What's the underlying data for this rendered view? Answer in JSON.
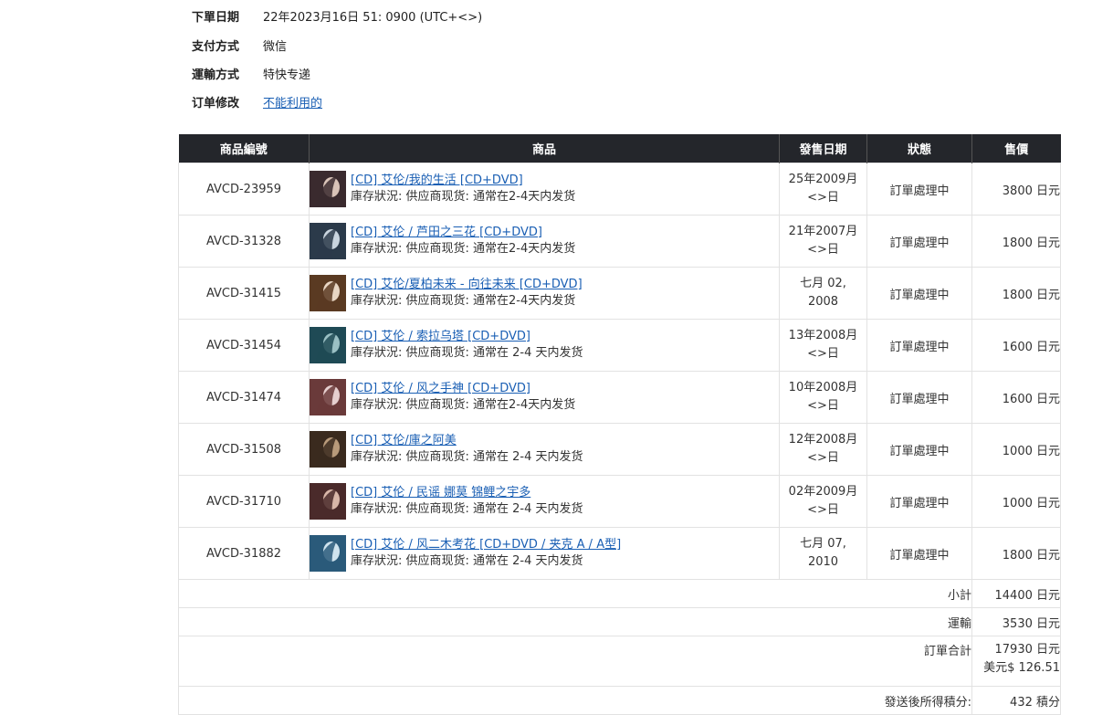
{
  "order_info": {
    "rows": [
      {
        "label": "下單日期",
        "value": "22年2023月16日 51: 0900 (UTC+<>)"
      },
      {
        "label": "支付方式",
        "value": "微信"
      },
      {
        "label": "運輸方式",
        "value": "特快专递"
      },
      {
        "label": "订单修改",
        "value": "不能利用的"
      }
    ]
  },
  "table": {
    "headers": [
      "商品編號",
      "商品",
      "發售日期",
      "狀態",
      "售價"
    ],
    "rows": [
      {
        "code": "AVCD-23959",
        "title": "[CD] 艾伦/我的生活 [CD+DVD]",
        "stock": "庫存狀況:  供应商现货: 通常在2-4天内发货",
        "date_line1": "25年2009月",
        "date_line2": "<>日",
        "status": "訂單處理中",
        "price": "3800 日元",
        "thumb_colors": [
          "#3a2a2e",
          "#d9c3b8"
        ]
      },
      {
        "code": "AVCD-31328",
        "title": "[CD] 艾伦 / 芦田之三花 [CD+DVD]",
        "stock": "庫存狀況:  供应商现货: 通常在2-4天内发货",
        "date_line1": "21年2007月",
        "date_line2": "<>日",
        "status": "訂單處理中",
        "price": "1800 日元",
        "thumb_colors": [
          "#2b3a4a",
          "#c9d4de"
        ]
      },
      {
        "code": "AVCD-31415",
        "title": "[CD] 艾伦/夏柏未来 - 向往未来 [CD+DVD]",
        "stock": "庫存狀況:  供应商现货: 通常在2-4天内发货",
        "date_line1": "七月 02,",
        "date_line2": "2008",
        "status": "訂單處理中",
        "price": "1800 日元",
        "thumb_colors": [
          "#5a3a22",
          "#e8d6c4"
        ]
      },
      {
        "code": "AVCD-31454",
        "title": "[CD] 艾伦 / 索拉乌塔 [CD+DVD]",
        "stock": "庫存狀況:  供应商现货: 通常在 2-4 天内发货",
        "date_line1": "13年2008月",
        "date_line2": "<>日",
        "status": "訂單處理中",
        "price": "1600 日元",
        "thumb_colors": [
          "#1f4a55",
          "#9ac0c4"
        ]
      },
      {
        "code": "AVCD-31474",
        "title": "[CD] 艾伦 / 风之手神 [CD+DVD]",
        "stock": "庫存狀況:  供应商现货: 通常在2-4天内发货",
        "date_line1": "10年2008月",
        "date_line2": "<>日",
        "status": "訂單處理中",
        "price": "1600 日元",
        "thumb_colors": [
          "#6a3a3a",
          "#e6cfcf"
        ]
      },
      {
        "code": "AVCD-31508",
        "title": "[CD] 艾伦/庫之阿美",
        "stock": "庫存狀況:  供应商现货: 通常在 2-4 天内发货",
        "date_line1": "12年2008月",
        "date_line2": "<>日",
        "status": "訂單處理中",
        "price": "1000 日元",
        "thumb_colors": [
          "#3a2a1e",
          "#b89a7a"
        ]
      },
      {
        "code": "AVCD-31710",
        "title": "[CD] 艾伦 / 民谣 娜莫 锦鲤之宇多",
        "stock": "庫存狀況:  供应商现货: 通常在 2-4 天内发货",
        "date_line1": "02年2009月",
        "date_line2": "<>日",
        "status": "訂單處理中",
        "price": "1000 日元",
        "thumb_colors": [
          "#4a2a2a",
          "#d8b6a8"
        ]
      },
      {
        "code": "AVCD-31882",
        "title": "[CD] 艾伦 / 风二木考花 [CD+DVD / 夹克 A / A型]",
        "stock": "庫存狀況:  供应商现货: 通常在 2-4 天内发货",
        "date_line1": "七月 07,",
        "date_line2": "2010",
        "status": "訂單處理中",
        "price": "1800 日元",
        "thumb_colors": [
          "#2a5a7a",
          "#cfe3ee"
        ]
      }
    ],
    "summary": {
      "subtotal_label": "小計",
      "subtotal_value": "14400 日元",
      "shipping_label": "運輸",
      "shipping_value": "3530 日元",
      "total_label": "訂單合計",
      "total_value": "17930 日元",
      "total_usd": "美元$ 126.51",
      "points_label": "發送後所得積分:",
      "points_value": "432 積分"
    }
  }
}
